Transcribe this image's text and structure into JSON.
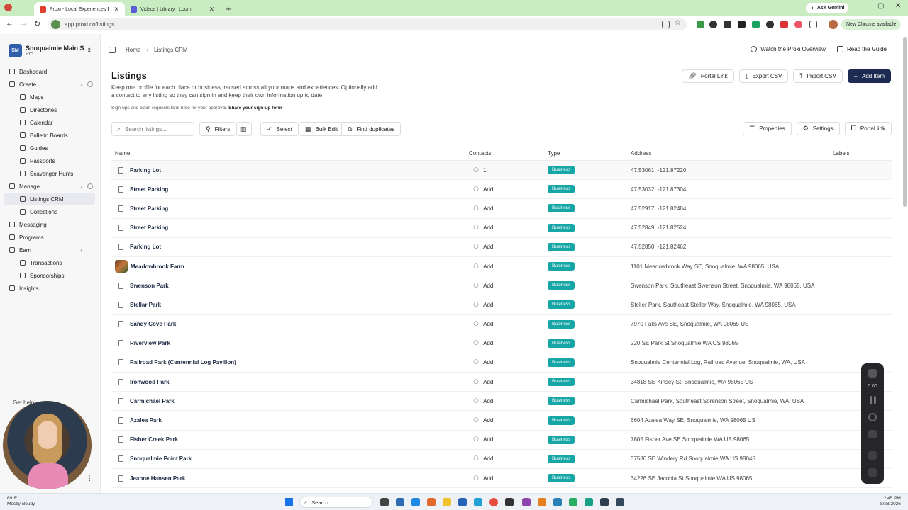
{
  "browser": {
    "tabs": [
      {
        "title": "Proxi - Local Experiences Engi",
        "active": true,
        "favicon_color": "#e0402e"
      },
      {
        "title": "Videos | Library | Loom",
        "active": false,
        "favicon_color": "#5b5bd6"
      }
    ],
    "new_tab_label": "+",
    "gemini_label": "Ask Gemini",
    "url": "app.proxi.co/listings",
    "new_chrome_label": "New Chrome available",
    "controls": {
      "minimize": "–",
      "maximize": "▢",
      "close": "✕",
      "back": "←",
      "forward": "→",
      "reload": "↻"
    }
  },
  "workspace": {
    "initials": "SM",
    "name": "Snoqualmie Main Str...",
    "plan": "Pro"
  },
  "sidebar": {
    "items": [
      {
        "label": "Dashboard",
        "sub": false
      },
      {
        "label": "Create",
        "sub": false,
        "arrow": "›",
        "info": true
      },
      {
        "label": "Maps",
        "sub": true
      },
      {
        "label": "Directories",
        "sub": true
      },
      {
        "label": "Calendar",
        "sub": true
      },
      {
        "label": "Bulletin Boards",
        "sub": true
      },
      {
        "label": "Guides",
        "sub": true
      },
      {
        "label": "Passports",
        "sub": true
      },
      {
        "label": "Scavenger Hunts",
        "sub": true
      },
      {
        "label": "Manage",
        "sub": false,
        "arrow": "›",
        "info": true
      },
      {
        "label": "Listings CRM",
        "sub": true,
        "active": true
      },
      {
        "label": "Collections",
        "sub": true
      },
      {
        "label": "Messaging",
        "sub": false
      },
      {
        "label": "Programs",
        "sub": false
      },
      {
        "label": "Earn",
        "sub": false,
        "arrow": "›"
      },
      {
        "label": "Transactions",
        "sub": true
      },
      {
        "label": "Sponsorships",
        "sub": true
      },
      {
        "label": "Insights",
        "sub": false
      }
    ],
    "get_help": "Get help",
    "more": "⋮"
  },
  "breadcrumb": {
    "home": "Home",
    "current": "Listings CRM",
    "sep": "›"
  },
  "top_links": {
    "watch": "Watch the Proxi Overview",
    "guide": "Read the Guide"
  },
  "page": {
    "title": "Listings",
    "description": "Keep one profile for each place or business, reused across all your maps and experiences. Optionally add a contact to any listing so they can sign in and keep their own information up to date.",
    "signup_text": "Sign-ups and claim requests land here for your approval.",
    "signup_link": "Share your sign-up form"
  },
  "actions": {
    "portal_link": "Portal Link",
    "export_csv": "Export CSV",
    "import_csv": "Import CSV",
    "add_item": "Add Item"
  },
  "filters": {
    "search_placeholder": "Search listings...",
    "filters": "Filters",
    "select": "Select",
    "bulk_edit": "Bulk Edit",
    "find_duplicates": "Find duplicates",
    "properties": "Properties",
    "settings": "Settings",
    "portal_link": "Portal link"
  },
  "table": {
    "columns": {
      "name": "Name",
      "contacts": "Contacts",
      "type": "Type",
      "address": "Address",
      "labels": "Labels"
    },
    "rows": [
      {
        "name": "Parking Lot",
        "contacts": "1",
        "type": "Business",
        "address": "47.53061, -121.87220"
      },
      {
        "name": "Street Parking",
        "contacts": "Add",
        "type": "Business",
        "address": "47.53032, -121.87304"
      },
      {
        "name": "Street Parking",
        "contacts": "Add",
        "type": "Business",
        "address": "47.52917, -121.82484"
      },
      {
        "name": "Street Parking",
        "contacts": "Add",
        "type": "Business",
        "address": "47.52849, -121.82524"
      },
      {
        "name": "Parking Lot",
        "contacts": "Add",
        "type": "Business",
        "address": "47.52850, -121.82462"
      },
      {
        "name": "Meadowbrook Farm",
        "contacts": "Add",
        "type": "Business",
        "address": "1101 Meadowbrook Way SE, Snoqualmie, WA 98065, USA",
        "thumb": true
      },
      {
        "name": "Swenson Park",
        "contacts": "Add",
        "type": "Business",
        "address": "Swenson Park, Southeast Swenson Street, Snoqualmie, WA 98065, USA"
      },
      {
        "name": "Stellar Park",
        "contacts": "Add",
        "type": "Business",
        "address": "Steller Park, Southeast Steller Way, Snoqualmie, WA 98065, USA"
      },
      {
        "name": "Sandy Cove Park",
        "contacts": "Add",
        "type": "Business",
        "address": "7970 Falls Ave SE, Snoqualmie, WA 98065 US"
      },
      {
        "name": "Riverview Park",
        "contacts": "Add",
        "type": "Business",
        "address": "220 SE Park St Snoqualmie WA US 98065"
      },
      {
        "name": "Railroad Park (Centennial Log Pavilion)",
        "contacts": "Add",
        "type": "Business",
        "address": "Snoqualmie Centennial Log, Railroad Avenue, Snoqualmie, WA, USA"
      },
      {
        "name": "Ironwood Park",
        "contacts": "Add",
        "type": "Business",
        "address": "34818 SE Kinsey St, Snoqualmie, WA 98065 US"
      },
      {
        "name": "Carmichael Park",
        "contacts": "Add",
        "type": "Business",
        "address": "Carmichael Park, Southeast Sorenson Street, Snoqualmie, WA, USA"
      },
      {
        "name": "Azalea Park",
        "contacts": "Add",
        "type": "Business",
        "address": "6604 Azalea Way SE, Snoqualmie, WA 98065 US"
      },
      {
        "name": "Fisher Creek Park",
        "contacts": "Add",
        "type": "Business",
        "address": "7805 Fisher Ave SE Snoqualmie WA US 98065"
      },
      {
        "name": "Snoqualmie Point Park",
        "contacts": "Add",
        "type": "Business",
        "address": "37580 SE Windery Rd Snoqualmie WA US 98045"
      },
      {
        "name": "Jeanne Hansen Park",
        "contacts": "Add",
        "type": "Business",
        "address": "34226 SE Jacobia St Snoqualmie WA US 98065"
      }
    ]
  },
  "recorder": {
    "time": "0:00"
  },
  "taskbar": {
    "temp": "69°F",
    "weather": "Mostly cloudy",
    "search": "Search",
    "time": "2:45 PM",
    "date": "8/28/2026"
  },
  "colors": {
    "badge": "#16a6a6",
    "primary": "#1b2b52",
    "tabstrip": "#c9ecc2"
  }
}
